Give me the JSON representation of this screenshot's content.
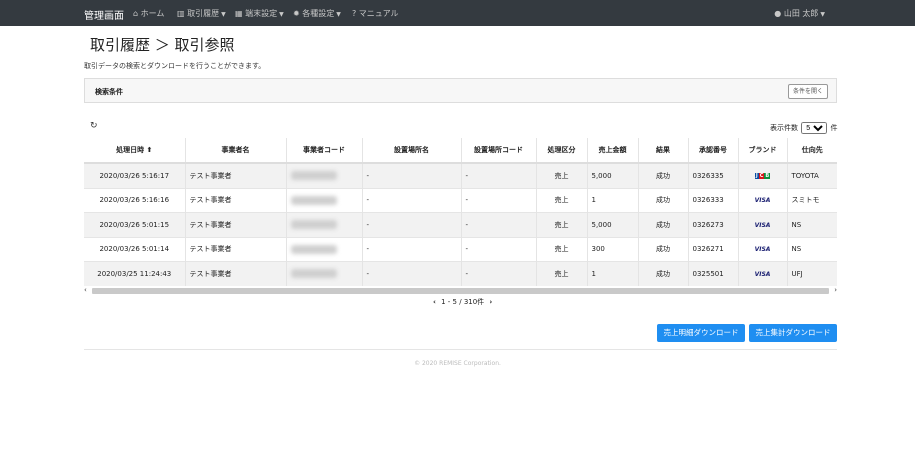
{
  "navbar": {
    "brand": "管理画面",
    "items": [
      {
        "icon": "home-icon",
        "label": "ホーム"
      },
      {
        "icon": "chart-icon",
        "label": "取引履歴"
      },
      {
        "icon": "terminal-icon",
        "label": "端末設定"
      },
      {
        "icon": "gear-icon",
        "label": "各種設定"
      },
      {
        "icon": "help-icon",
        "label": "マニュアル"
      }
    ],
    "user": "山田 太郎"
  },
  "page": {
    "title": "取引履歴 ＞ 取引参照",
    "description": "取引データの検索とダウンロードを行うことができます。"
  },
  "search": {
    "label": "検索条件",
    "open_button": "条件を開く"
  },
  "perpage": {
    "label_before": "表示件数",
    "value": "5",
    "label_after": "件"
  },
  "table": {
    "headers": [
      "処理日時",
      "事業者名",
      "事業者コード",
      "設置場所名",
      "設置場所コード",
      "処理区分",
      "売上金額",
      "結果",
      "承認番号",
      "ブランド",
      "仕向先"
    ],
    "rows": [
      {
        "datetime": "2020/03/26 5:16:17",
        "merchant": "テスト事業者",
        "location": "-",
        "location_code": "-",
        "type": "売上",
        "amount": "5,000",
        "result": "成功",
        "approval": "0326335",
        "brand": "JCB",
        "dest": "TOYOTA"
      },
      {
        "datetime": "2020/03/26 5:16:16",
        "merchant": "テスト事業者",
        "location": "-",
        "location_code": "-",
        "type": "売上",
        "amount": "1",
        "result": "成功",
        "approval": "0326333",
        "brand": "VISA",
        "dest": "スミトモ"
      },
      {
        "datetime": "2020/03/26 5:01:15",
        "merchant": "テスト事業者",
        "location": "-",
        "location_code": "-",
        "type": "売上",
        "amount": "5,000",
        "result": "成功",
        "approval": "0326273",
        "brand": "VISA",
        "dest": "NS"
      },
      {
        "datetime": "2020/03/26 5:01:14",
        "merchant": "テスト事業者",
        "location": "-",
        "location_code": "-",
        "type": "売上",
        "amount": "300",
        "result": "成功",
        "approval": "0326271",
        "brand": "VISA",
        "dest": "NS"
      },
      {
        "datetime": "2020/03/25 11:24:43",
        "merchant": "テスト事業者",
        "location": "-",
        "location_code": "-",
        "type": "売上",
        "amount": "1",
        "result": "成功",
        "approval": "0325501",
        "brand": "VISA",
        "dest": "UFJ"
      }
    ]
  },
  "pagination": {
    "text": "1 - 5 / 310件"
  },
  "buttons": {
    "sales_detail_download": "売上明細ダウンロード",
    "sales_summary_download": "売上集計ダウンロード"
  },
  "footer": {
    "copyright": "© 2020 REMISE Corporation."
  }
}
